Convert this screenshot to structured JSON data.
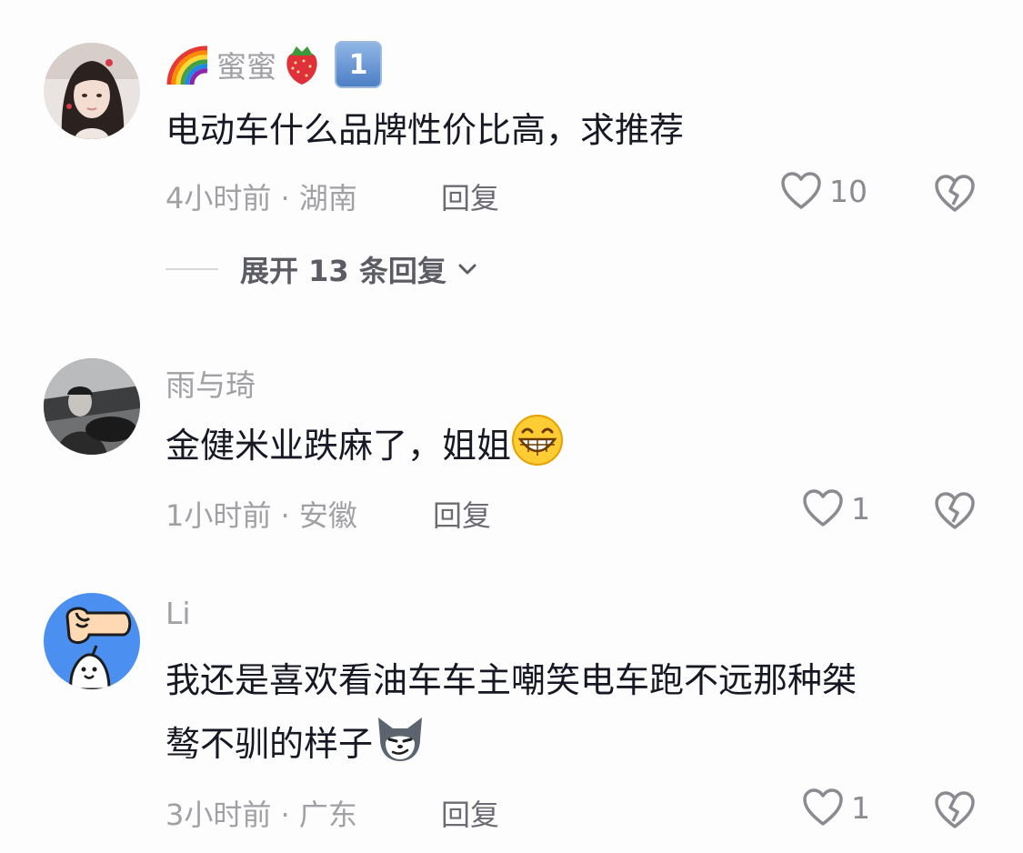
{
  "comments": [
    {
      "username": "蜜蜜",
      "badge": "1",
      "text": "电动车什么品牌性价比高，求推荐",
      "meta": "4小时前 · 湖南",
      "reply_label": "回复",
      "likes": "10",
      "expand_label": "展开 13 条回复"
    },
    {
      "username": "雨与琦",
      "text": "金健米业跌麻了，姐姐",
      "meta": "1小时前 · 安徽",
      "reply_label": "回复",
      "likes": "1"
    },
    {
      "username": "Li",
      "text_line1": "我还是喜欢看油车车主嘲笑电车跑不远那种桀",
      "text_line2": "骜不驯的样子",
      "meta": "3小时前 · 广东",
      "reply_label": "回复",
      "likes": "1"
    }
  ],
  "icons": {
    "like": "heart-outline-icon",
    "dislike": "broken-heart-icon",
    "expand": "chevron-down-icon"
  },
  "colors": {
    "text": "#161823",
    "muted": "#a0a0a5",
    "reply": "#6b6b72"
  }
}
